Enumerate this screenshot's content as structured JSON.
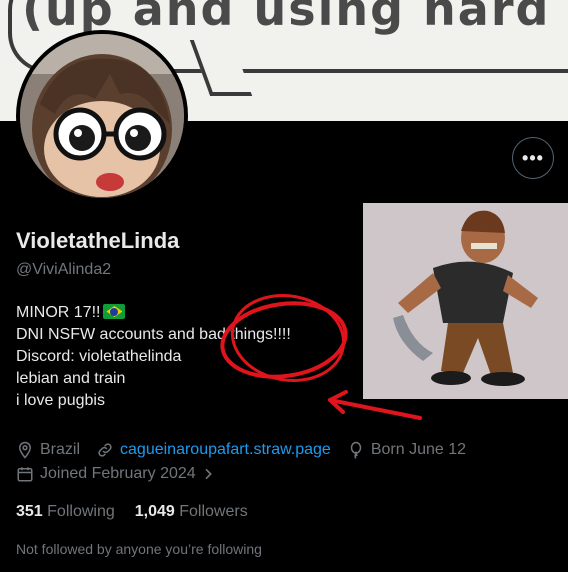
{
  "banner": {
    "text": "(up and using hard d"
  },
  "profile": {
    "display_name": "VioletatheLinda",
    "handle": "@ViviAlinda2",
    "more_label": "•••"
  },
  "bio": [
    "MINOR 17!!",
    "DNI NSFW accounts and bad things!!!!",
    "Discord: violetathelinda",
    "lebian and train",
    "i love pugbis"
  ],
  "meta": {
    "location": "Brazil",
    "website": "cagueinaroupafart.straw.page",
    "birthday": "Born June 12",
    "joined": "Joined February 2024"
  },
  "stats": {
    "following_count": "351",
    "following_label": "Following",
    "followers_count": "1,049",
    "followers_label": "Followers"
  },
  "not_followed_text": "Not followed by anyone you’re following",
  "colors": {
    "link": "#1d9bf0",
    "muted": "#71767b",
    "text": "#e7e9ea",
    "annotation": "#e0141c"
  },
  "icons": [
    "location-icon",
    "link-icon",
    "balloon-icon",
    "calendar-icon",
    "chevron-right-icon",
    "brazil-flag-icon"
  ]
}
